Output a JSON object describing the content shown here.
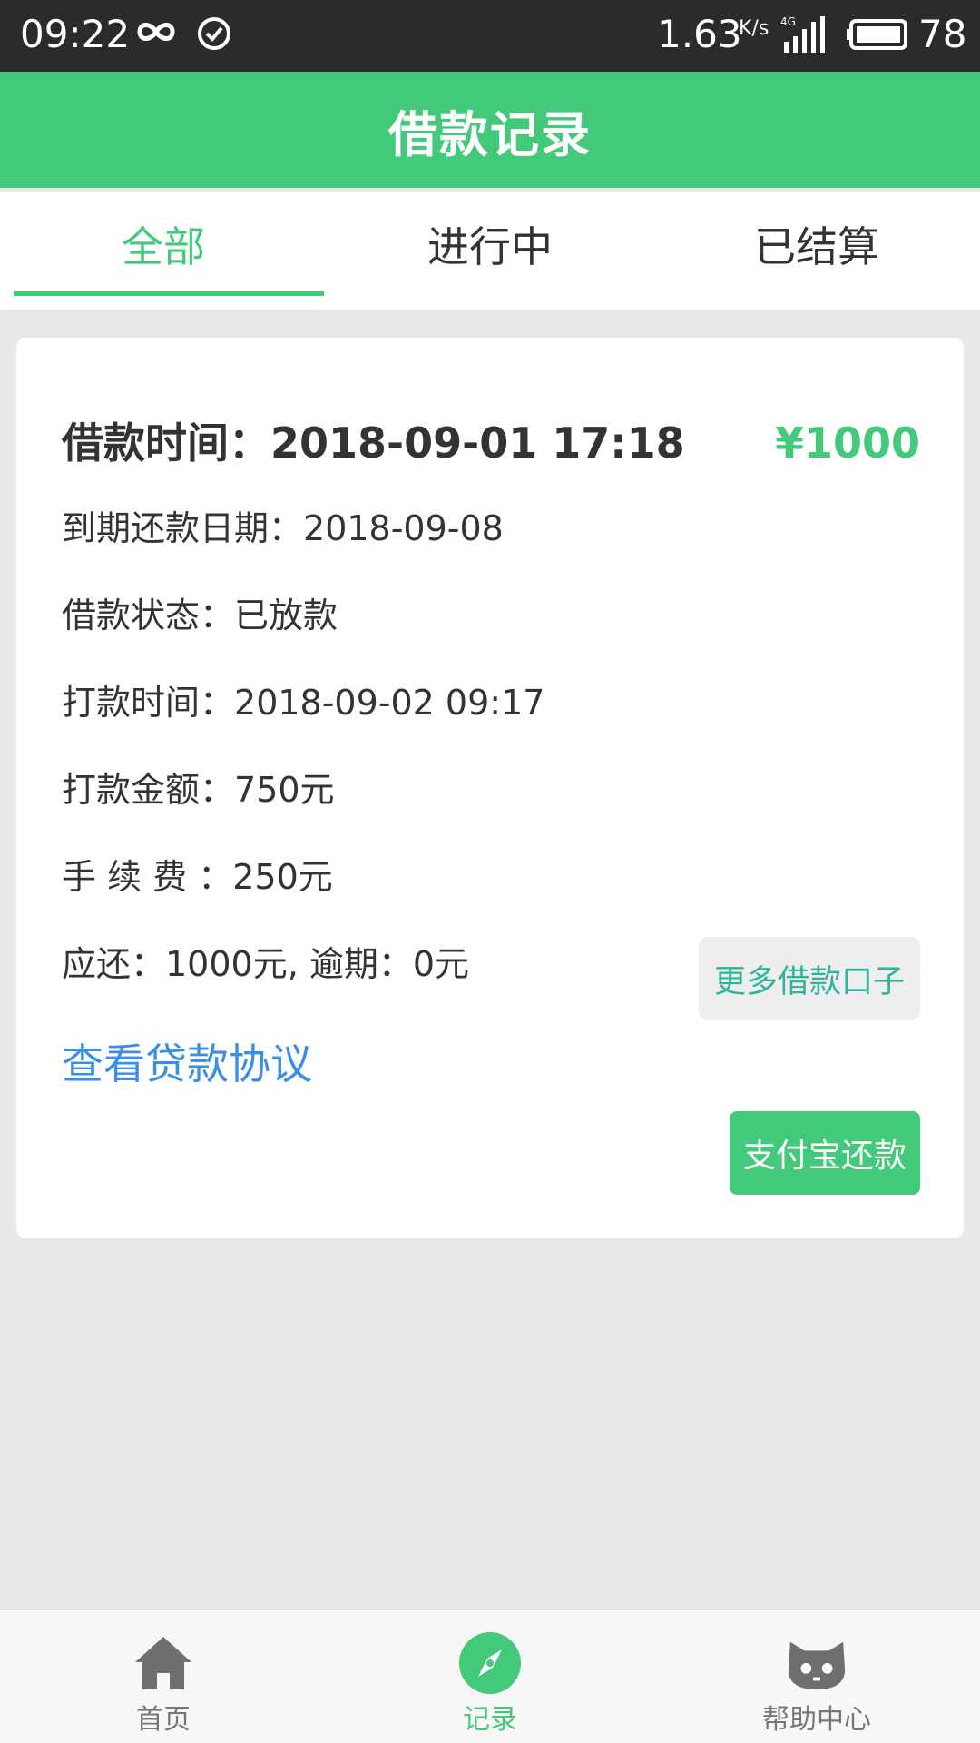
{
  "status_bar": {
    "time": "09:22",
    "speed": "1.63",
    "speed_unit": "K/s",
    "network": "4G",
    "battery": "78"
  },
  "header": {
    "title": "借款记录"
  },
  "tabs": [
    {
      "label": "全部",
      "active": true
    },
    {
      "label": "进行中",
      "active": false
    },
    {
      "label": "已结算",
      "active": false
    }
  ],
  "record": {
    "borrow_time_label": "借款时间：",
    "borrow_time": "2018-09-01 17:18",
    "amount": "¥1000",
    "due_date_label": "到期还款日期：",
    "due_date": "2018-09-08",
    "status_label": "借款状态：",
    "status": "已放款",
    "pay_time_label": "打款时间：",
    "pay_time": "2018-09-02 09:17",
    "pay_amount_label": "打款金额：",
    "pay_amount": "750元",
    "fee_label": "手 续 费 ：",
    "fee": "250元",
    "due_amount_text": "应还：1000元, 逾期：0元",
    "agreement_link": "查看贷款协议",
    "more_loans_button": "更多借款口子",
    "alipay_button": "支付宝还款"
  },
  "bottom_nav": [
    {
      "label": "首页",
      "icon": "home-icon",
      "active": false
    },
    {
      "label": "记录",
      "icon": "compass-icon",
      "active": true
    },
    {
      "label": "帮助中心",
      "icon": "cat-face-icon",
      "active": false
    }
  ],
  "colors": {
    "accent": "#42c97a",
    "link": "#3a8ee6",
    "status_bar": "#2b2b2b"
  }
}
